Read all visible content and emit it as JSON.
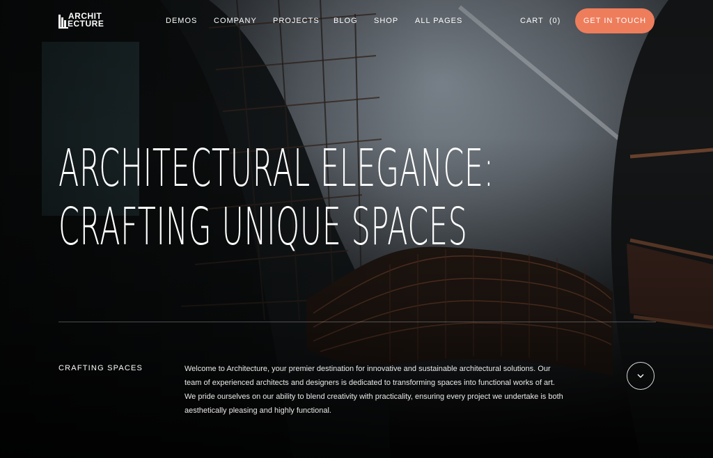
{
  "brand": {
    "line1": "ARCHIT",
    "line2": "ECTURE"
  },
  "nav": {
    "items": [
      {
        "label": "DEMOS"
      },
      {
        "label": "COMPANY"
      },
      {
        "label": "PROJECTS"
      },
      {
        "label": "BLOG"
      },
      {
        "label": "SHOP"
      },
      {
        "label": "ALL PAGES"
      }
    ],
    "cart_label": "CART",
    "cart_count": "(0)",
    "cta_label": "GET IN TOUCH"
  },
  "hero": {
    "headline_line1": "ARCHITECTURAL ELEGANCE:",
    "headline_line2": "CRAFTING UNIQUE SPACES",
    "section_label": "CRAFTING SPACES",
    "intro": "Welcome to Architecture, your premier destination for innovative and sustainable architectural solutions. Our team of experienced architects and designers is dedicated to transforming spaces into functional works of art. We pride ourselves on our ability to blend creativity with practicality, ensuring every project we undertake is both aesthetically pleasing and highly functional."
  },
  "colors": {
    "accent": "#ee7d5c",
    "background": "#0c0c0c",
    "text": "#ffffff"
  },
  "icons": {
    "scroll": "chevron-down-icon",
    "logo": "building-logo-icon"
  }
}
